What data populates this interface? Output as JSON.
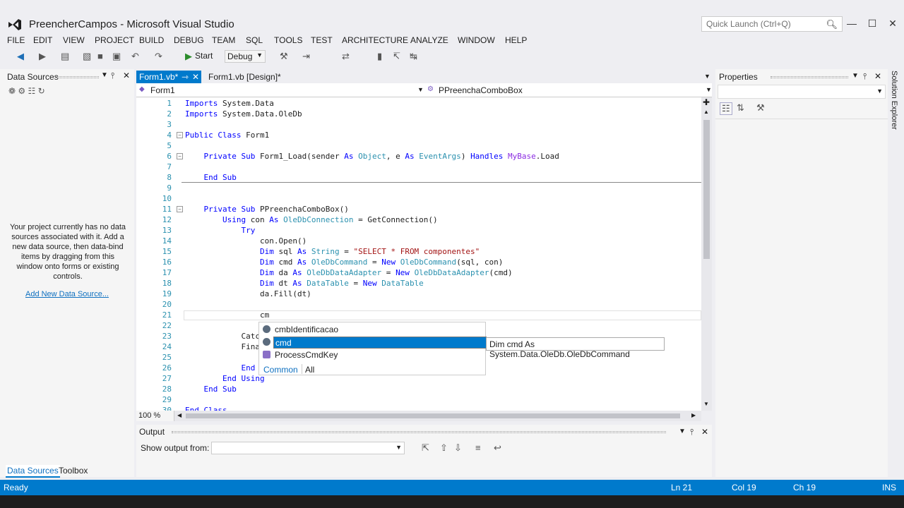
{
  "window": {
    "title": "PreencherCampos - Microsoft Visual Studio",
    "quick_launch_placeholder": "Quick Launch (Ctrl+Q)"
  },
  "menu": [
    "FILE",
    "EDIT",
    "VIEW",
    "PROJECT",
    "BUILD",
    "DEBUG",
    "TEAM",
    "SQL",
    "TOOLS",
    "TEST",
    "ARCHITECTURE",
    "ANALYZE",
    "WINDOW",
    "HELP"
  ],
  "toolbar": {
    "start_label": "Start",
    "config": "Debug"
  },
  "data_sources": {
    "title": "Data Sources",
    "message": "Your project currently has no data sources associated with it. Add a new data source, then data-bind items by dragging from this window onto forms or existing controls.",
    "link": "Add New Data Source..."
  },
  "left_tabs": [
    "Data Sources",
    "Toolbox"
  ],
  "doc_tabs": {
    "active": "Form1.vb*",
    "other": "Form1.vb [Design]*"
  },
  "nav": {
    "class_dropdown": "Form1",
    "member_dropdown": "PPreenchaComboBox"
  },
  "code": {
    "lines": [
      {
        "n": "1",
        "t": "Imports System.Data"
      },
      {
        "n": "2",
        "t": "Imports System.Data.OleDb"
      },
      {
        "n": "3",
        "t": ""
      },
      {
        "n": "4",
        "t": "Public Class Form1"
      },
      {
        "n": "5",
        "t": ""
      },
      {
        "n": "6",
        "t": "    Private Sub Form1_Load(sender As Object, e As EventArgs) Handles MyBase.Load"
      },
      {
        "n": "7",
        "t": ""
      },
      {
        "n": "8",
        "t": "    End Sub"
      },
      {
        "n": "9",
        "t": ""
      },
      {
        "n": "10",
        "t": ""
      },
      {
        "n": "11",
        "t": "    Private Sub PPreenchaComboBox()"
      },
      {
        "n": "12",
        "t": "        Using con As OleDbConnection = GetConnection()"
      },
      {
        "n": "13",
        "t": "            Try"
      },
      {
        "n": "14",
        "t": "                con.Open()"
      },
      {
        "n": "15",
        "t": "                Dim sql As String = \"SELECT * FROM componentes\""
      },
      {
        "n": "16",
        "t": "                Dim cmd As OleDbCommand = New OleDbCommand(sql, con)"
      },
      {
        "n": "17",
        "t": "                Dim da As OleDbDataAdapter = New OleDbDataAdapter(cmd)"
      },
      {
        "n": "18",
        "t": "                Dim dt As DataTable = New DataTable"
      },
      {
        "n": "19",
        "t": "                da.Fill(dt)"
      },
      {
        "n": "20",
        "t": ""
      },
      {
        "n": "21",
        "t": "                cm"
      },
      {
        "n": "22",
        "t": ""
      },
      {
        "n": "23",
        "t": "            Catc"
      },
      {
        "n": "24",
        "t": "            Fina"
      },
      {
        "n": "25",
        "t": ""
      },
      {
        "n": "26",
        "t": "            End"
      },
      {
        "n": "27",
        "t": "        End Using"
      },
      {
        "n": "28",
        "t": "    End Sub"
      },
      {
        "n": "29",
        "t": ""
      },
      {
        "n": "30",
        "t": "End Class"
      }
    ]
  },
  "zoom": "100 %",
  "intellisense": {
    "items": [
      "cmbIdentificacao",
      "cmd",
      "ProcessCmdKey"
    ],
    "selected_index": 1,
    "tabs": [
      "Common",
      "All"
    ],
    "tooltip": "Dim cmd As System.Data.OleDb.OleDbCommand"
  },
  "output": {
    "title": "Output",
    "show_label": "Show output from:"
  },
  "properties": {
    "title": "Properties"
  },
  "solution_explorer": "Solution Explorer",
  "status": {
    "ready": "Ready",
    "line": "Ln 21",
    "col": "Col 19",
    "ch": "Ch 19",
    "mode": "INS"
  },
  "colors": {
    "accent": "#007acc",
    "keyword": "#0000ff",
    "type": "#2b91af",
    "string": "#a31515"
  }
}
